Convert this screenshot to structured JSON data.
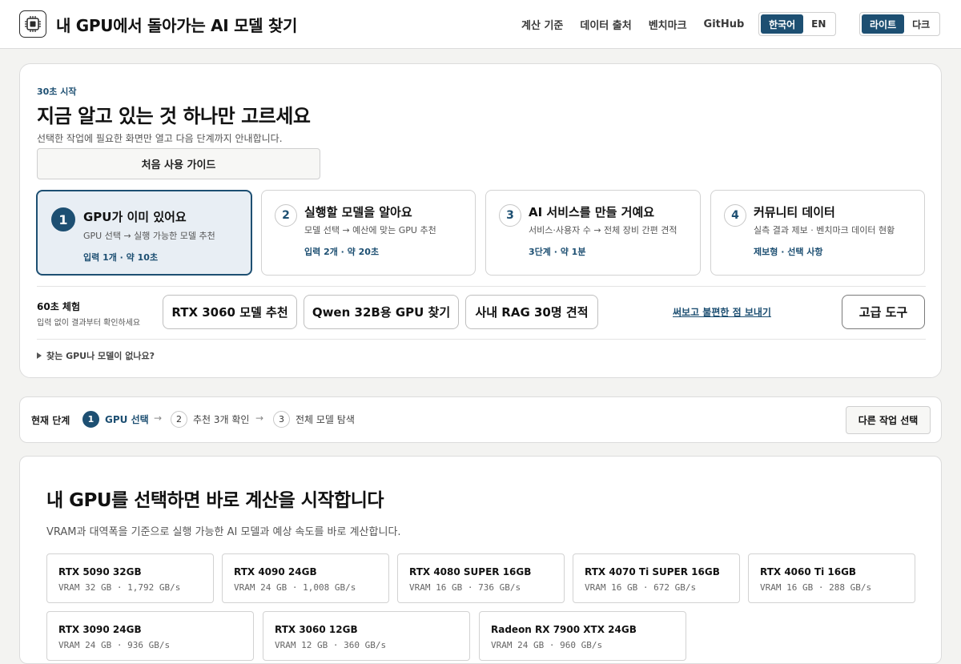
{
  "header": {
    "title": "내 GPU에서 돌아가는 AI 모델 찾기",
    "nav": [
      "계산 기준",
      "데이터 출처",
      "벤치마크",
      "GitHub"
    ],
    "lang": {
      "options": [
        "한국어",
        "EN"
      ],
      "active": "한국어"
    },
    "theme": {
      "options": [
        "라이트",
        "다크"
      ],
      "active": "라이트"
    }
  },
  "start": {
    "eyebrow": "30초 시작",
    "title": "지금 알고 있는 것 하나만 고르세요",
    "subtitle": "선택한 작업에 필요한 화면만 열고 다음 단계까지 안내합니다.",
    "guide_button": "처음 사용 가이드",
    "options": [
      {
        "num": "1",
        "title": "GPU가 이미 있어요",
        "desc": "GPU 선택 → 실행 가능한 모델 추천",
        "meta": "입력 1개 · 약 10초"
      },
      {
        "num": "2",
        "title": "실행할 모델을 알아요",
        "desc": "모델 선택 → 예산에 맞는 GPU 추천",
        "meta": "입력 2개 · 약 20초"
      },
      {
        "num": "3",
        "title": "AI 서비스를 만들 거예요",
        "desc": "서비스·사용자 수 → 전체 장비 간편 견적",
        "meta": "3단계 · 약 1분"
      },
      {
        "num": "4",
        "title": "커뮤니티 데이터",
        "desc": "실측 결과 제보 · 벤치마크 데이터 현황",
        "meta": "제보형 · 선택 사항"
      }
    ],
    "try_label": "60초 체험",
    "try_sub": "입력 없이 결과부터 확인하세요",
    "chips": [
      "RTX 3060 모델 추천",
      "Qwen 32B용 GPU 찾기",
      "사내 RAG 30명 견적"
    ],
    "feedback_link": "써보고 불편한 점 보내기",
    "advanced_button": "고급 도구",
    "missing_toggle": "찾는 GPU나 모델이 없나요?"
  },
  "steps": {
    "label": "현재 단계",
    "items": [
      {
        "num": "1",
        "text": "GPU 선택"
      },
      {
        "num": "2",
        "text": "추천 3개 확인"
      },
      {
        "num": "3",
        "text": "전체 모델 탐색"
      }
    ],
    "arrow": "→",
    "other_button": "다른 작업 선택"
  },
  "gpu": {
    "title": "내 GPU를 선택하면 바로 계산을 시작합니다",
    "subtitle": "VRAM과 대역폭을 기준으로 실행 가능한 AI 모델과 예상 속도를 바로 계산합니다.",
    "tiles": [
      {
        "name": "RTX 5090 32GB",
        "spec": "VRAM 32 GB · 1,792 GB/s"
      },
      {
        "name": "RTX 4090 24GB",
        "spec": "VRAM 24 GB · 1,008 GB/s"
      },
      {
        "name": "RTX 4080 SUPER 16GB",
        "spec": "VRAM 16 GB · 736 GB/s"
      },
      {
        "name": "RTX 4070 Ti SUPER 16GB",
        "spec": "VRAM 16 GB · 672 GB/s"
      },
      {
        "name": "RTX 4060 Ti 16GB",
        "spec": "VRAM 16 GB · 288 GB/s"
      },
      {
        "name": "RTX 3090 24GB",
        "spec": "VRAM 24 GB · 936 GB/s"
      },
      {
        "name": "RTX 3060 12GB",
        "spec": "VRAM 12 GB · 360 GB/s"
      },
      {
        "name": "Radeon RX 7900 XTX 24GB",
        "spec": "VRAM 24 GB · 960 GB/s"
      }
    ]
  },
  "colors": {
    "accent": "#1d4f72",
    "accent_bg": "#e8eef4",
    "page_bg": "#f3f3f1"
  }
}
